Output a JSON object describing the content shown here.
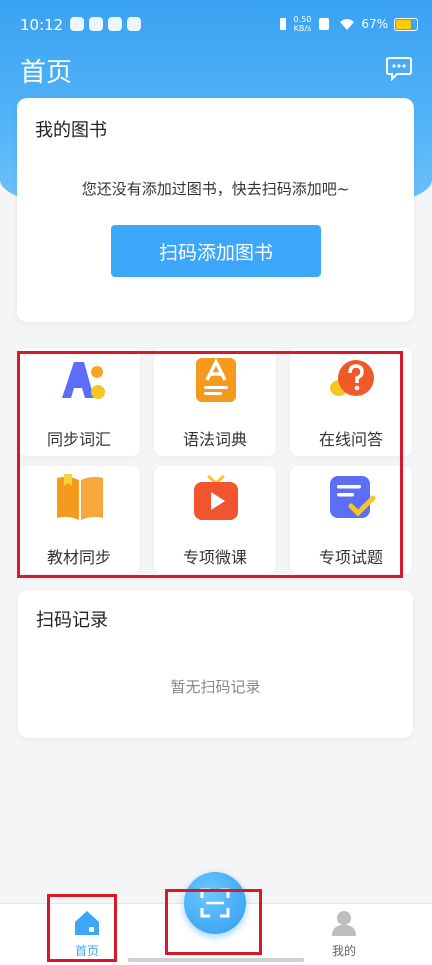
{
  "status_bar": {
    "time": "10:12",
    "net_speed_value": "0.50",
    "net_speed_unit": "KB/s",
    "battery": "67%"
  },
  "header": {
    "title": "首页"
  },
  "my_books": {
    "title": "我的图书",
    "empty_text": "您还没有添加过图书，快去扫码添加吧~",
    "scan_add_label": "扫码添加图书"
  },
  "features": [
    {
      "label": "同步词汇",
      "icon": "abc-letters-icon"
    },
    {
      "label": "语法词典",
      "icon": "grammar-book-icon"
    },
    {
      "label": "在线问答",
      "icon": "question-bubble-icon"
    },
    {
      "label": "教材同步",
      "icon": "open-book-icon"
    },
    {
      "label": "专项微课",
      "icon": "video-play-icon"
    },
    {
      "label": "专项试题",
      "icon": "checklist-icon"
    }
  ],
  "scan_records": {
    "title": "扫码记录",
    "empty_text": "暂无扫码记录"
  },
  "bottom_nav": {
    "home_label": "首页",
    "mine_label": "我的"
  },
  "colors": {
    "accent": "#3ca6f8",
    "highlight_box": "#d8192a"
  }
}
